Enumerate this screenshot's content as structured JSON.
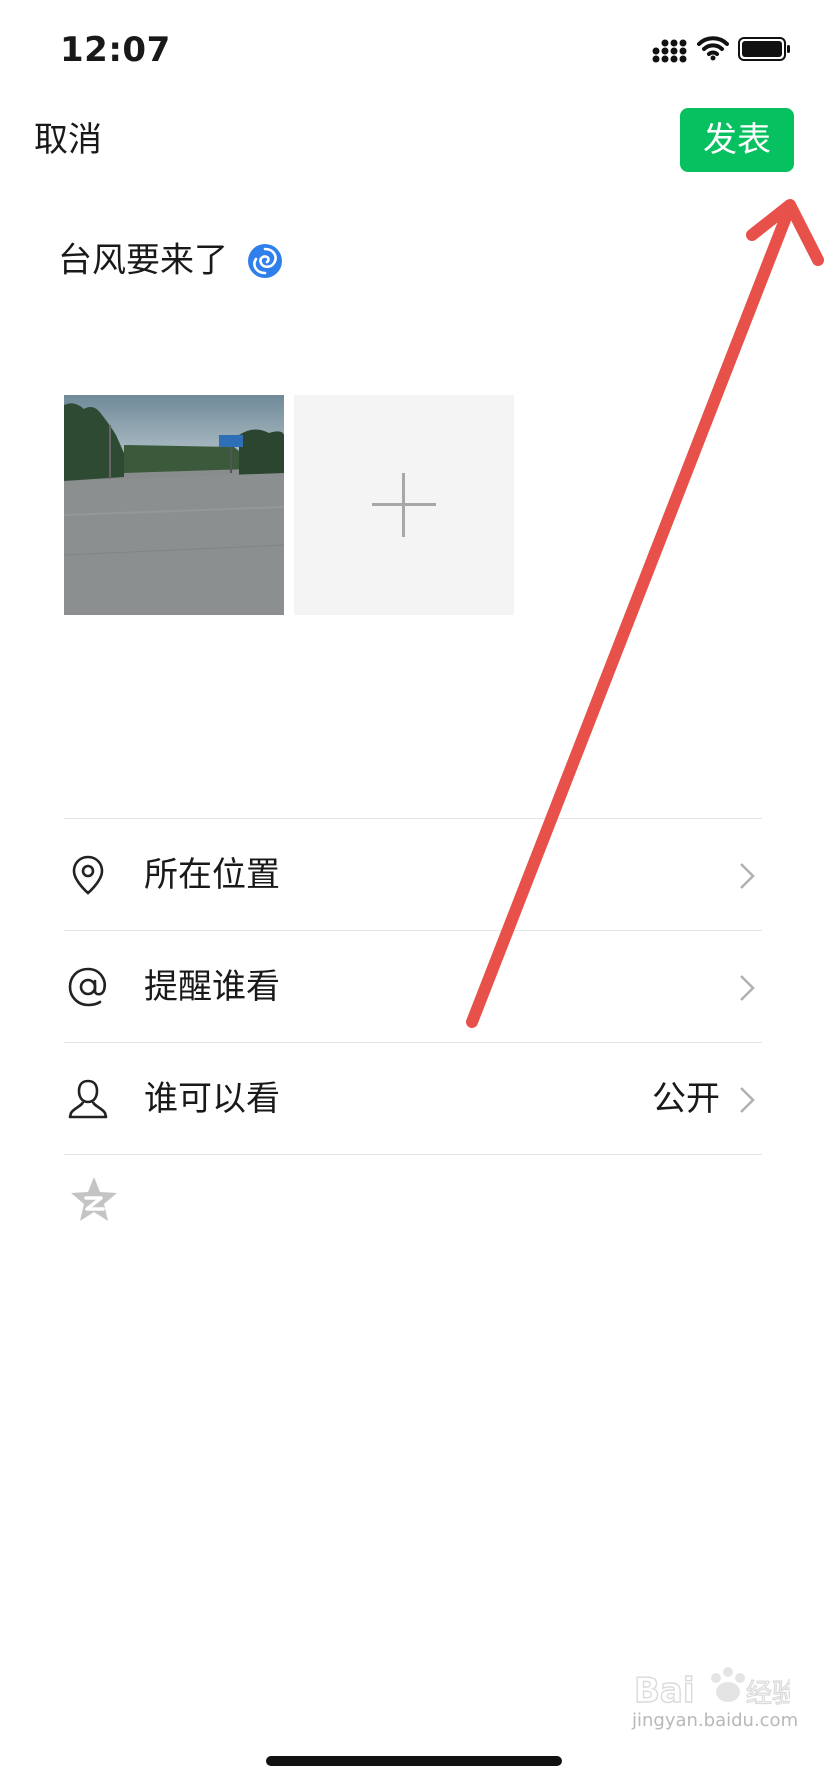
{
  "status_bar": {
    "time": "12:07"
  },
  "nav": {
    "cancel_label": "取消",
    "publish_label": "发表"
  },
  "post": {
    "text": "台风要来了",
    "emoji_icon": "cyclone-icon"
  },
  "photos": {
    "items": [
      {
        "name": "road-photo",
        "description_icon": "image-thumbnail"
      }
    ],
    "add_icon": "plus-icon"
  },
  "options": {
    "location": {
      "label": "所在位置",
      "icon": "location-pin-icon"
    },
    "mention": {
      "label": "提醒谁看",
      "icon": "at-icon"
    },
    "visibility": {
      "label": "谁可以看",
      "value": "公开",
      "icon": "person-icon"
    }
  },
  "colors": {
    "accent": "#07c160",
    "annotation": "#e8504a",
    "divider": "#e5e5e5"
  }
}
